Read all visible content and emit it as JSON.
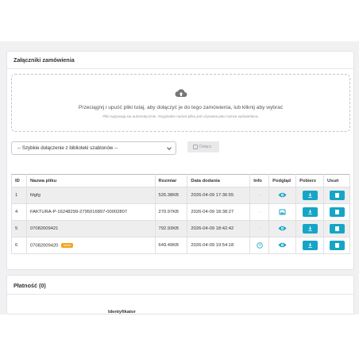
{
  "attachments_card": {
    "title": "Załączniki zamówienia",
    "dropzone": {
      "main_text": "Przeciągnij i upuść pliki tutaj, aby dołączyć je do tego zamówienia, lub kliknij aby wybrać",
      "sub_text": "Pliki wgrywają się automatycznie. Oryginalne nazwa pliku jest używana jako nazwa wyświetlana.",
      "icon": "cloud-upload-icon"
    },
    "template_select": {
      "value": "-- Szybkie dołączenie z biblioteki szablonów --"
    },
    "attach_button": {
      "label": "Dołącz"
    },
    "table": {
      "headers": {
        "id": "ID",
        "name": "Nazwa pliku",
        "size": "Rozmiar",
        "date": "Data dodania",
        "info": "Info",
        "preview": "Podgląd",
        "download": "Pobierz",
        "delete": "Usuń"
      },
      "rows": [
        {
          "id": "1",
          "name": "fdgfg",
          "badge": "",
          "size": "526.38KB",
          "date": "2026-04-09 17:36:55",
          "info": "-",
          "preview": "eye"
        },
        {
          "id": "4",
          "name": "FAKTURA-P-16248299-2795016897-00002807",
          "badge": "",
          "size": "270.97KB",
          "date": "2026-04-09 18:38:27",
          "info": "-",
          "preview": "image"
        },
        {
          "id": "5",
          "name": "07082009421",
          "badge": "",
          "size": "792.93KB",
          "date": "2026-04-09 18:42:42",
          "info": "-",
          "preview": "eye"
        },
        {
          "id": "6",
          "name": "07082009420",
          "badge": "klient",
          "size": "649.49KB",
          "date": "2026-04-09 19:54:18",
          "info": "clock",
          "preview": "eye"
        }
      ]
    }
  },
  "payment_card": {
    "title": "Płatność (0)",
    "partial_header": "Identyfikator"
  },
  "colors": {
    "accent": "#16a5c6",
    "badge": "#f5a21b",
    "page_bg": "#f1f1f3"
  }
}
